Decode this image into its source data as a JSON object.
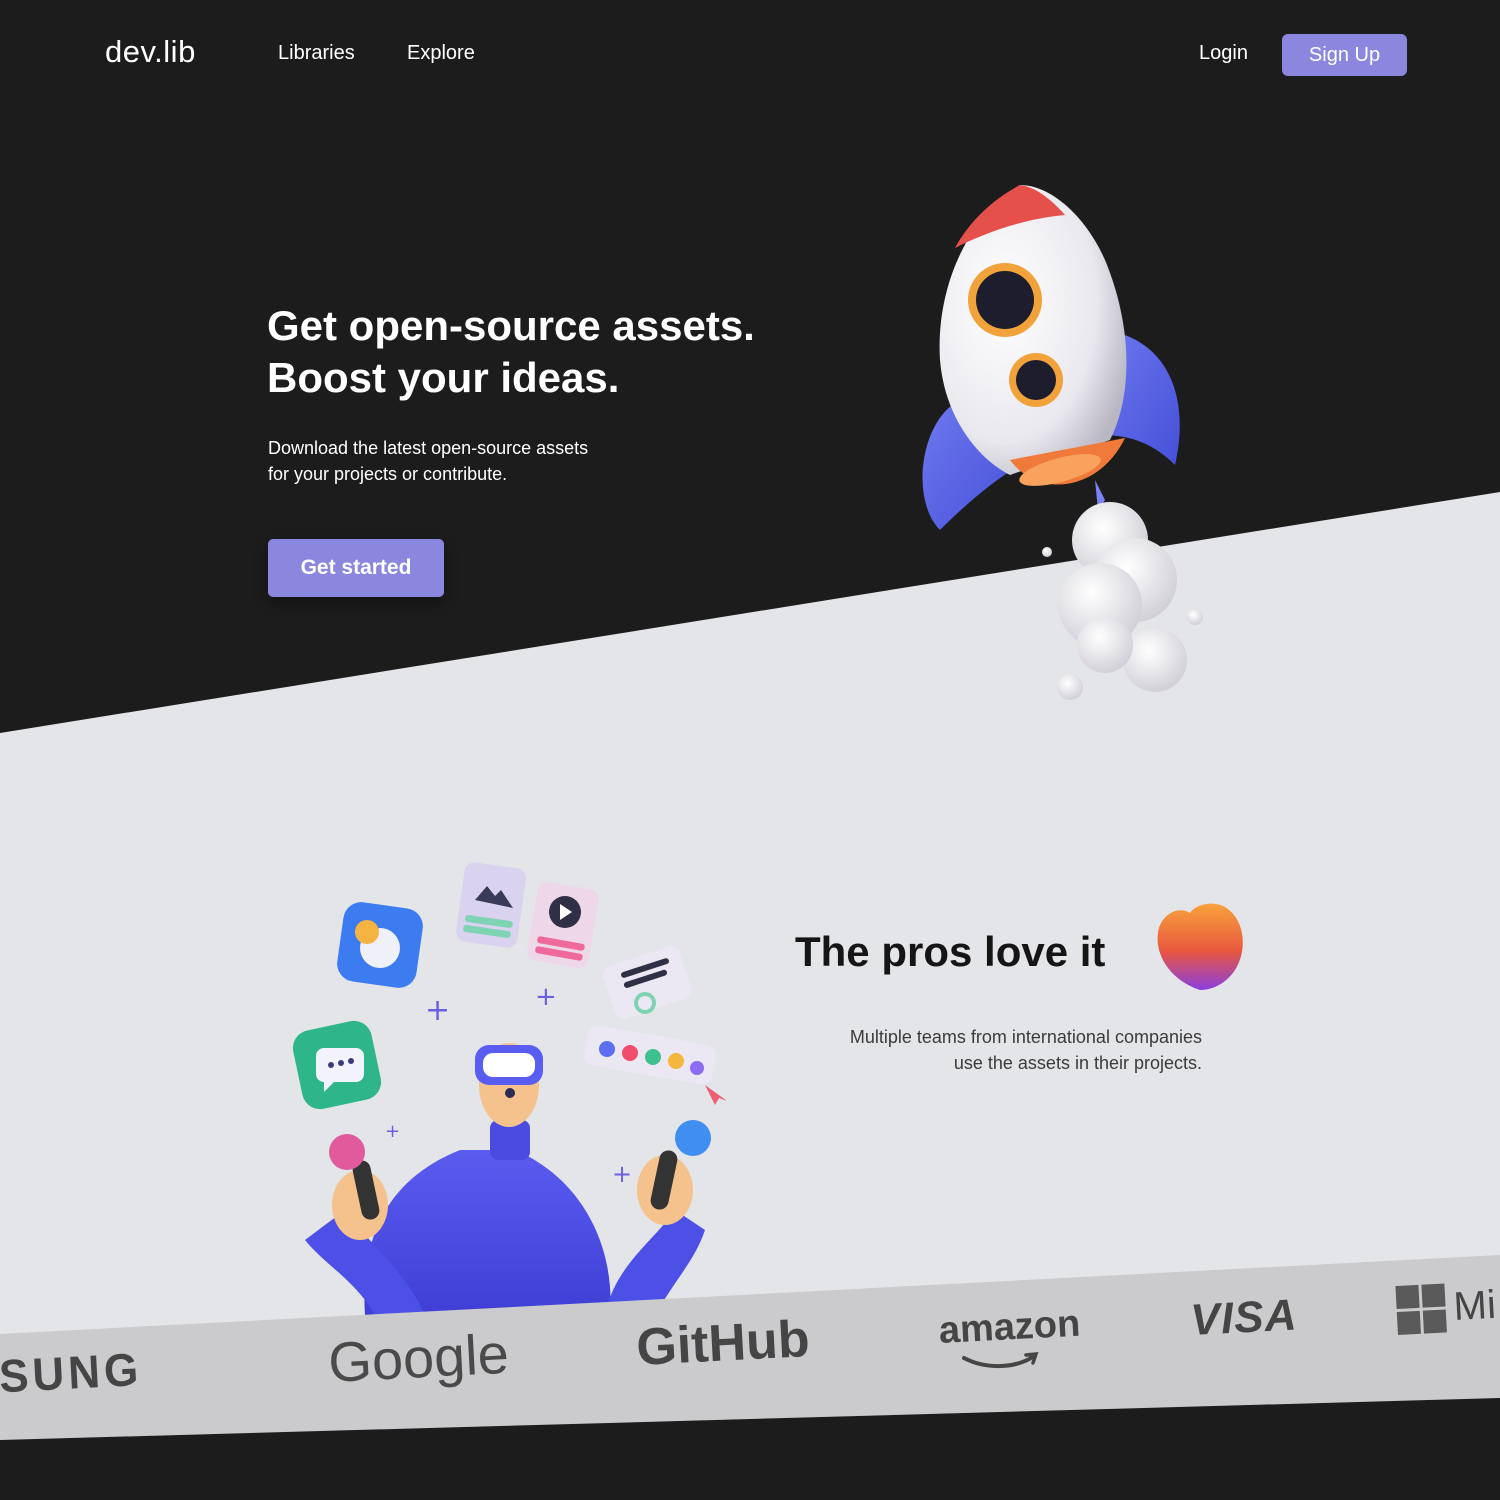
{
  "nav": {
    "brand": "dev.lib",
    "links": [
      "Libraries",
      "Explore"
    ],
    "login": "Login",
    "signup": "Sign Up"
  },
  "hero": {
    "title_lines": [
      "Get open-source assets.",
      "Boost your ideas."
    ],
    "subtitle_lines": [
      "Download the latest open-source assets",
      "for your projects or contribute."
    ],
    "cta": "Get started"
  },
  "pros": {
    "title": "The pros love it",
    "subtitle_lines": [
      "Multiple teams from international companies",
      "use the assets in their projects."
    ]
  },
  "logos": [
    "MSUNG",
    "Google",
    "GitHub",
    "amazon",
    "VISA",
    "Mi"
  ],
  "colors": {
    "dark_bg": "#1c1c1d",
    "light_bg": "#e4e5e9",
    "accent": "#8c87de",
    "logo_strip": "#cbcbce"
  },
  "icons": [
    "rocket-illustration",
    "heart-icon",
    "vr-person-illustration",
    "microsoft-logo-icon"
  ]
}
